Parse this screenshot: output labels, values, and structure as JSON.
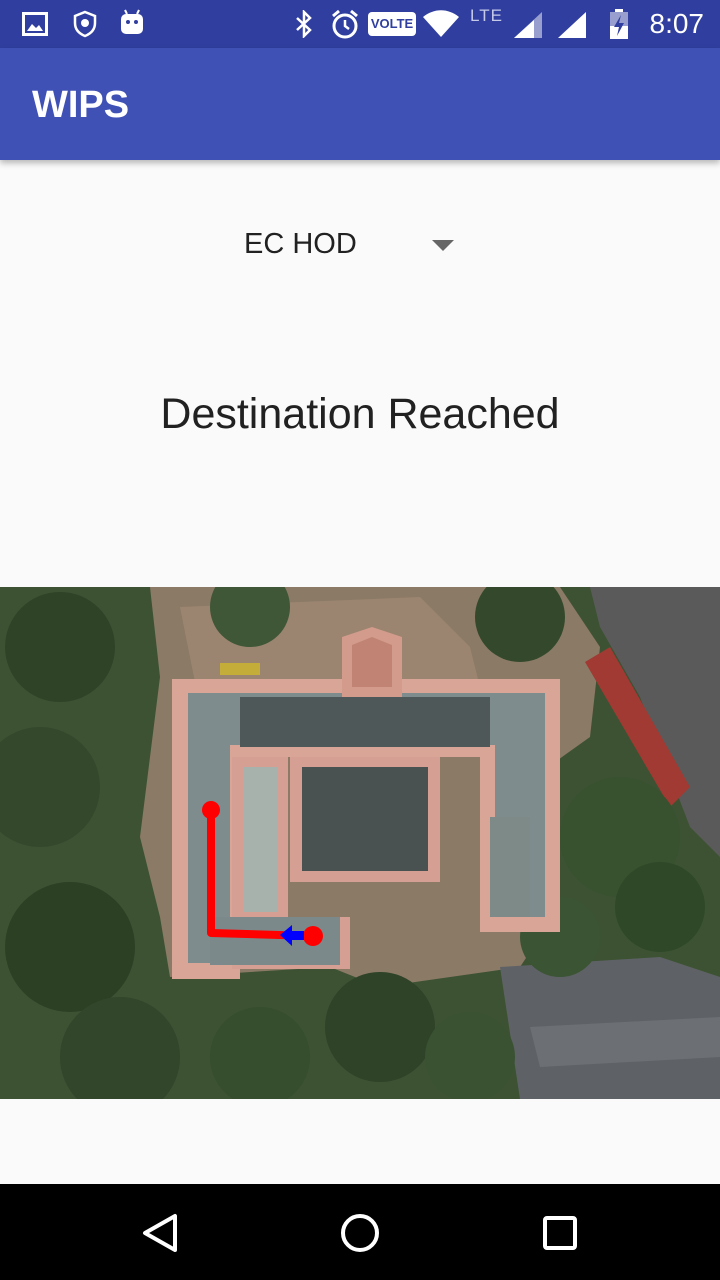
{
  "status_bar": {
    "time": "8:07",
    "volte_label": "VOLTE",
    "network_label": "LTE",
    "icons": [
      "image-icon",
      "shield-icon",
      "android-icon",
      "bluetooth-icon",
      "alarm-icon",
      "volte-badge",
      "wifi-icon",
      "signal-icon",
      "signal-icon-2",
      "battery-charging-icon"
    ]
  },
  "app_bar": {
    "title": "WIPS",
    "color": "#3f51b5"
  },
  "destination_spinner": {
    "selected": "EC HOD"
  },
  "status_message": "Destination Reached",
  "map": {
    "path_color": "#ff0000",
    "marker_color": "#0000ff"
  },
  "nav_bar": {
    "icons": [
      "back-icon",
      "home-icon",
      "recents-icon"
    ]
  }
}
